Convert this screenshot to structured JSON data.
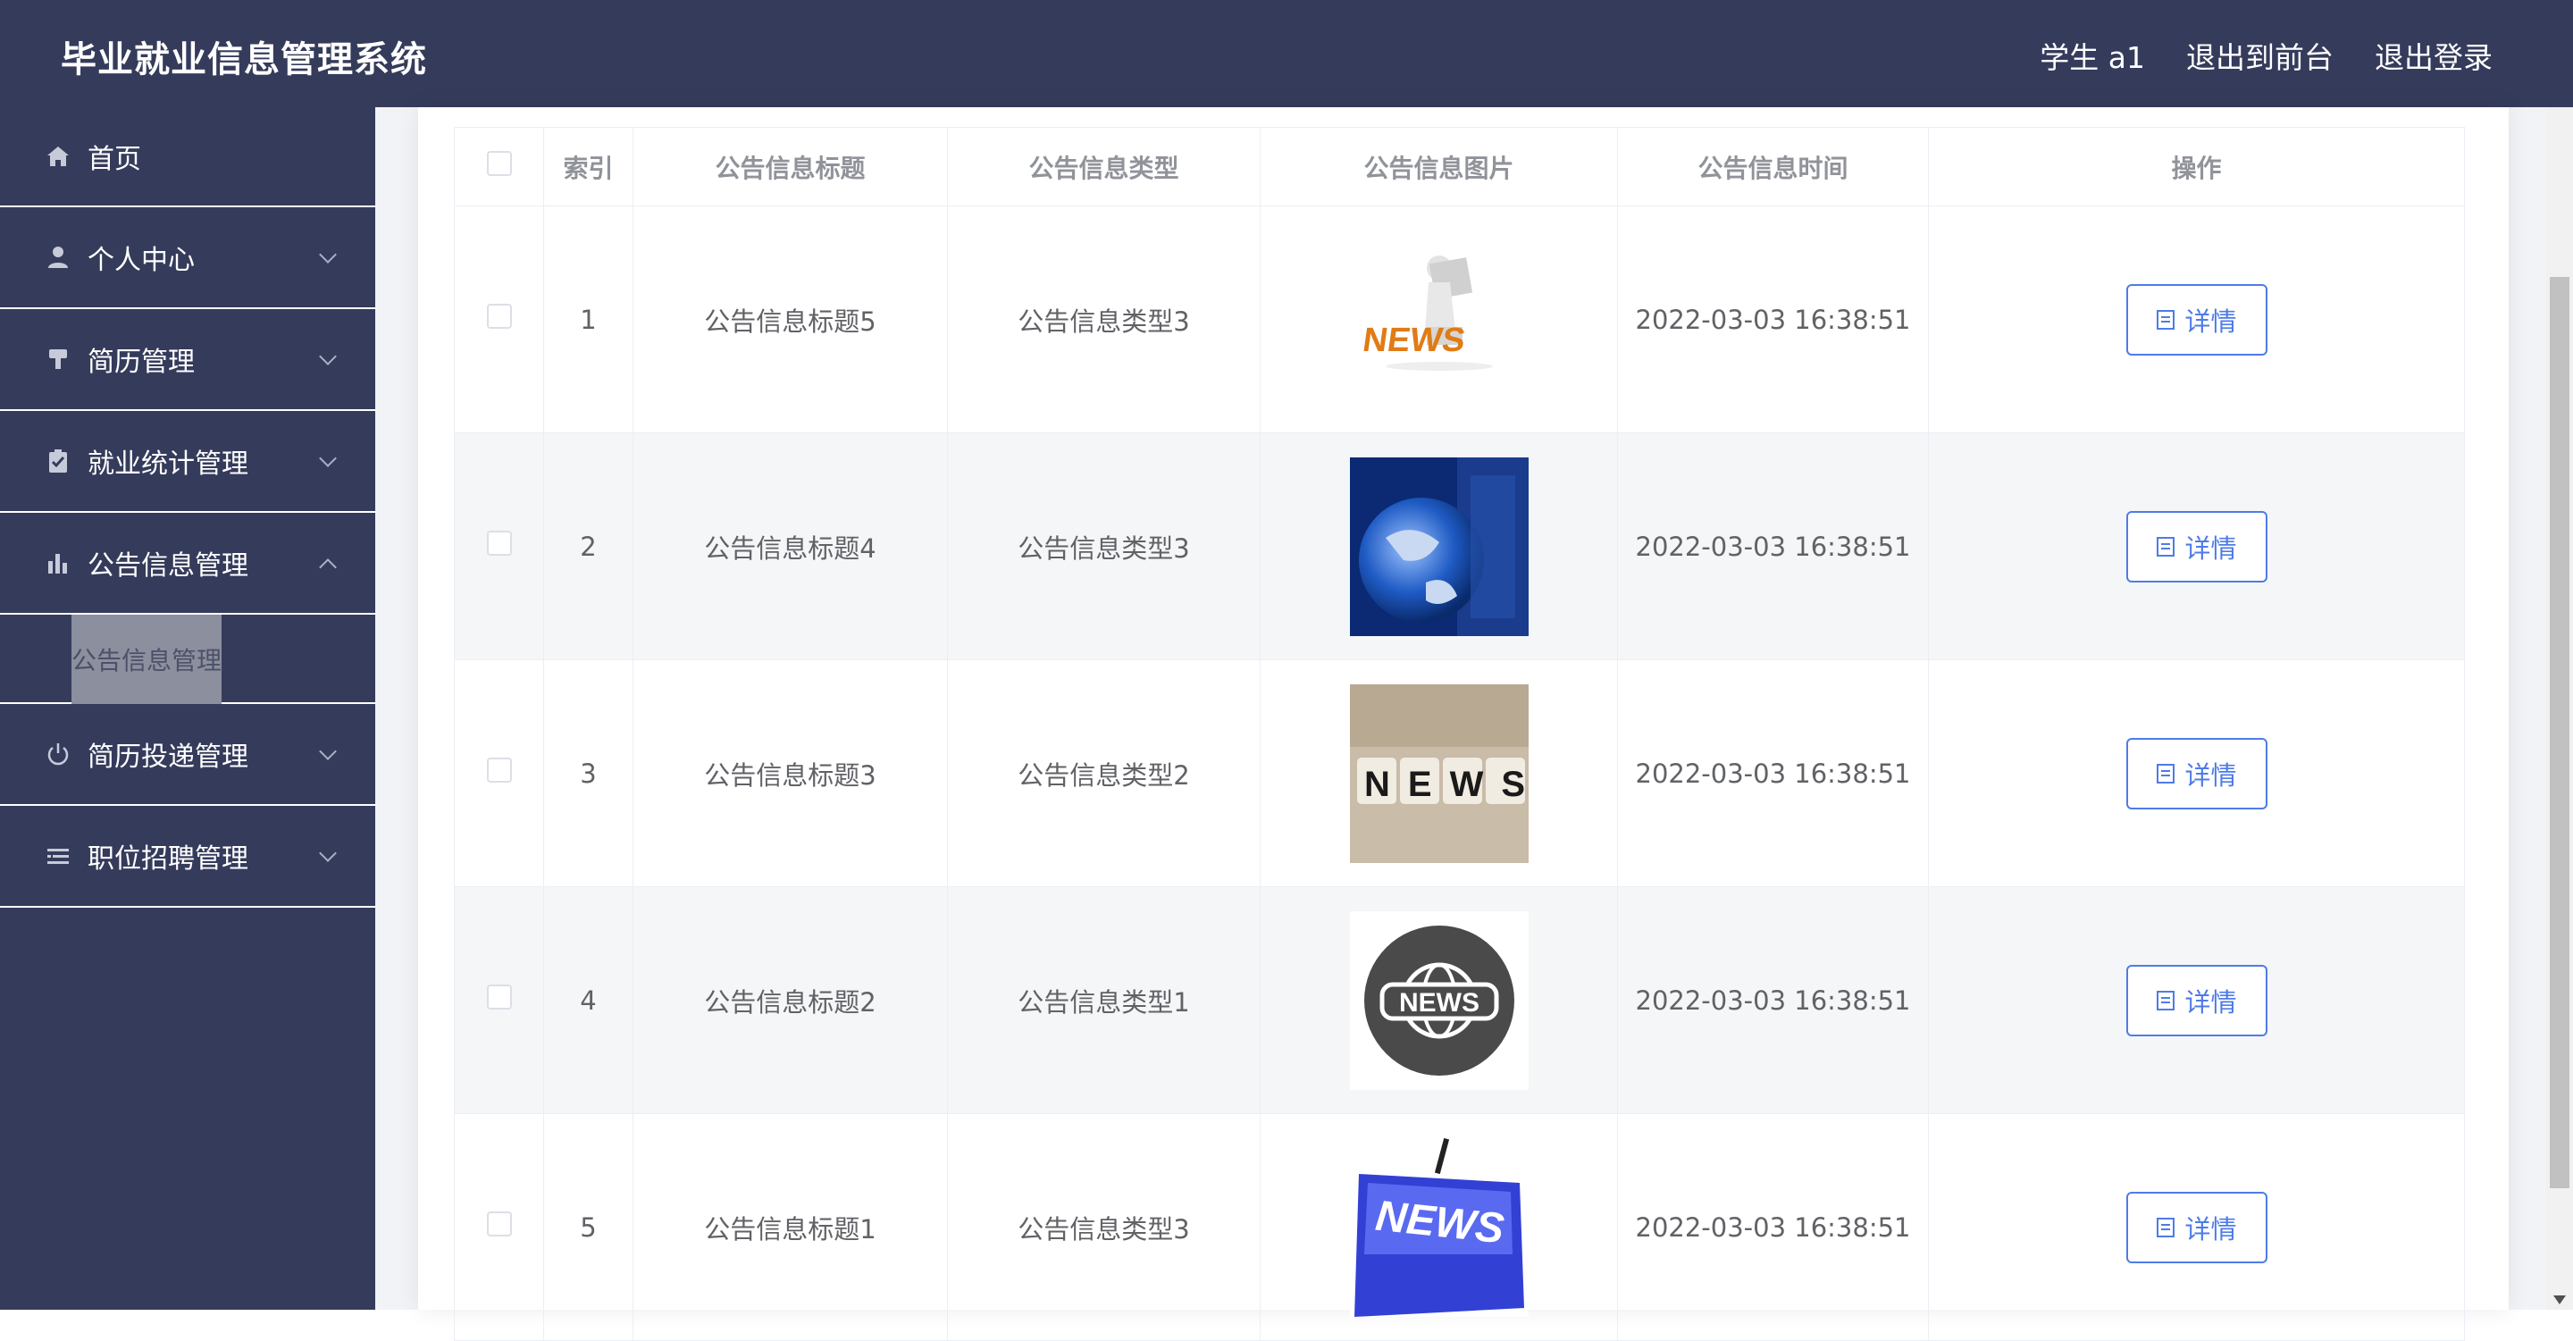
{
  "app": {
    "title": "毕业就业信息管理系统"
  },
  "header": {
    "user_label": "学生 a1",
    "front_label": "退出到前台",
    "logout_label": "退出登录"
  },
  "sidebar": {
    "items": [
      {
        "label": "首页",
        "icon": "home-icon"
      },
      {
        "label": "个人中心",
        "icon": "user-icon"
      },
      {
        "label": "简历管理",
        "icon": "brush-icon"
      },
      {
        "label": "就业统计管理",
        "icon": "clipboard-check-icon"
      },
      {
        "label": "公告信息管理",
        "icon": "bar-chart-icon",
        "expanded": true
      },
      {
        "label": "简历投递管理",
        "icon": "power-icon"
      },
      {
        "label": "职位招聘管理",
        "icon": "list-icon"
      }
    ],
    "subitem": "公告信息管理"
  },
  "table": {
    "headers": [
      "索引",
      "公告信息标题",
      "公告信息类型",
      "公告信息图片",
      "公告信息时间",
      "操作"
    ],
    "detail_label": "详情",
    "rows": [
      {
        "index": "1",
        "title": "公告信息标题5",
        "type": "公告信息类型3",
        "image": "news-figure-reading",
        "time": "2022-03-03 16:38:51"
      },
      {
        "index": "2",
        "title": "公告信息标题4",
        "type": "公告信息类型3",
        "image": "news-globe",
        "time": "2022-03-03 16:38:51"
      },
      {
        "index": "3",
        "title": "公告信息标题3",
        "type": "公告信息类型2",
        "image": "news-dice",
        "time": "2022-03-03 16:38:51"
      },
      {
        "index": "4",
        "title": "公告信息标题2",
        "type": "公告信息类型1",
        "image": "news-globe-badge",
        "time": "2022-03-03 16:38:51"
      },
      {
        "index": "5",
        "title": "公告信息标题1",
        "type": "公告信息类型3",
        "image": "news-keyboard-key",
        "time": "2022-03-03 16:38:51"
      }
    ]
  },
  "image_text": {
    "news": "NEWS"
  },
  "colors": {
    "header_bg": "#353b5b",
    "accent": "#4e7be8"
  }
}
